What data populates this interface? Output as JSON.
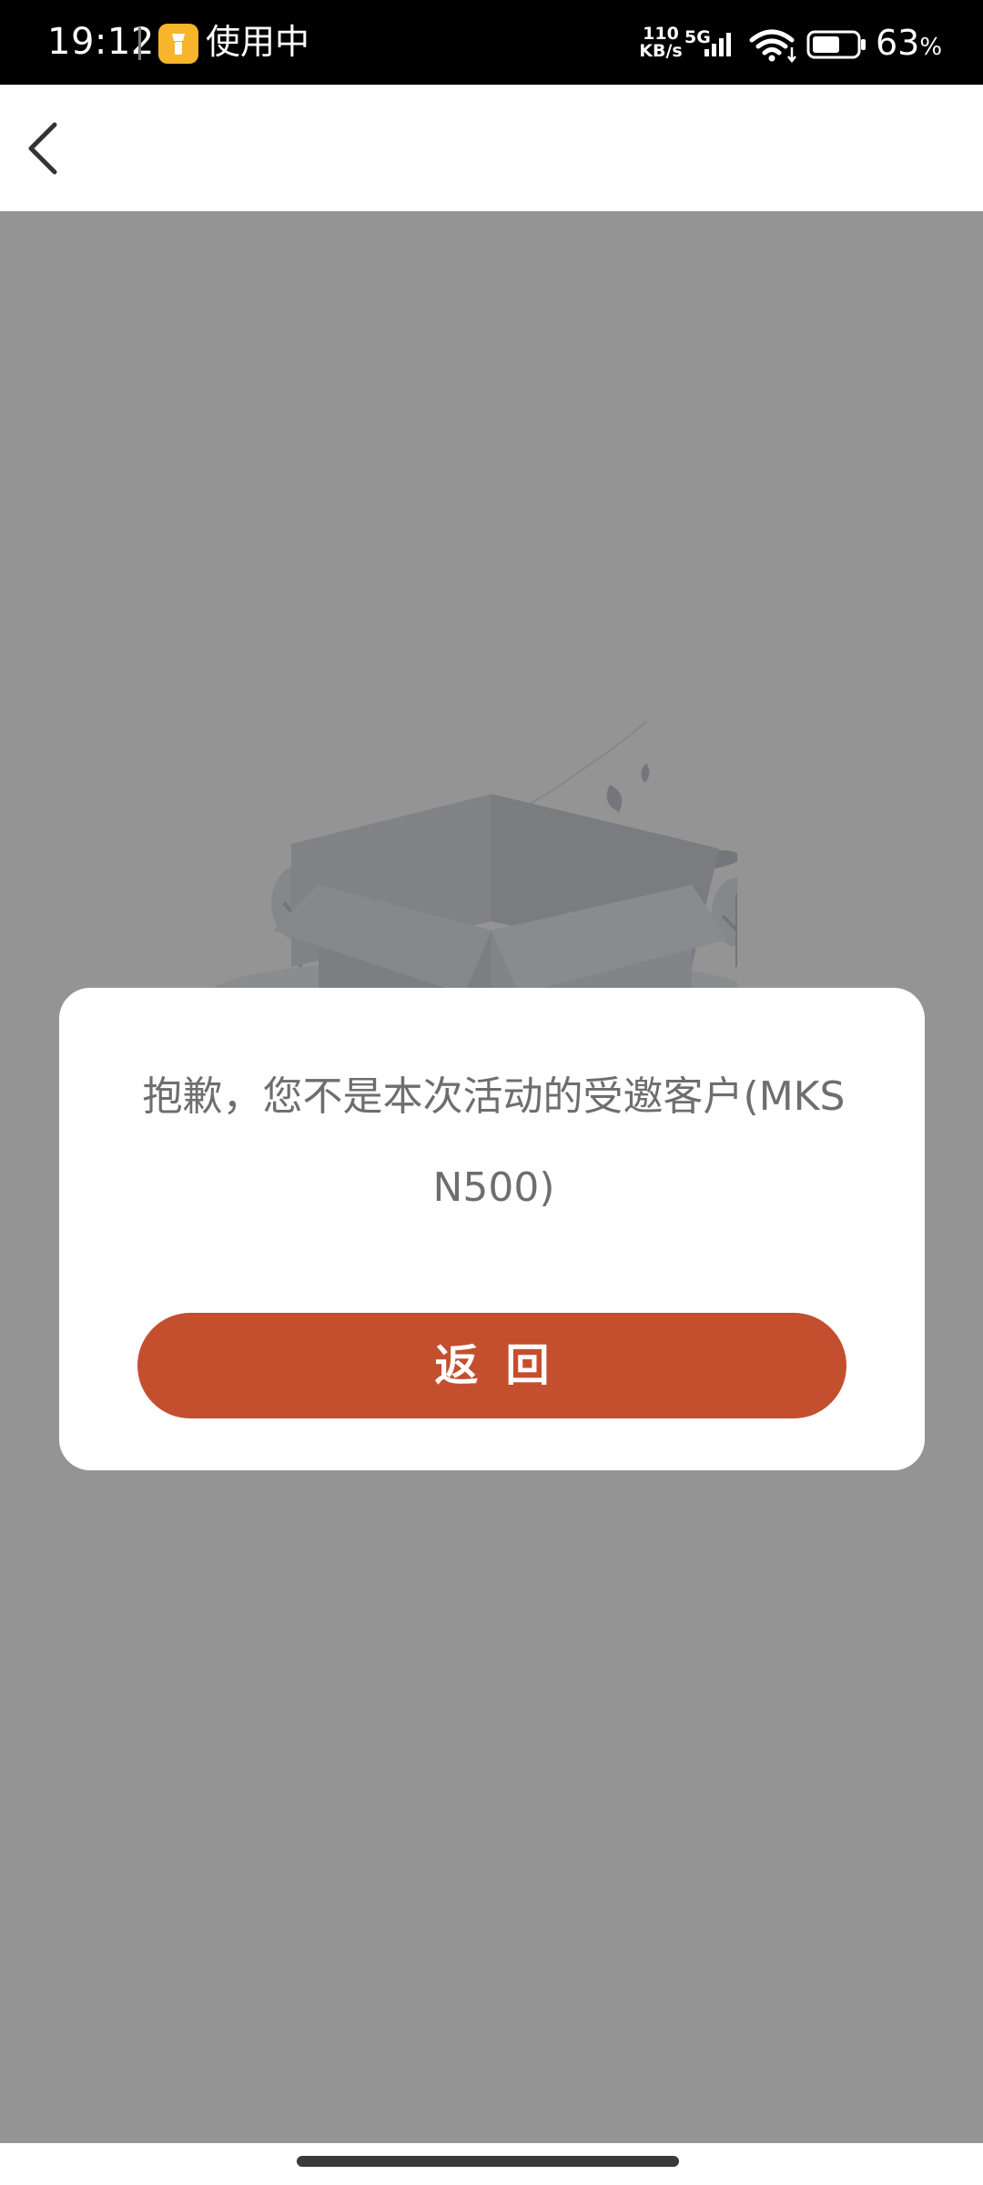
{
  "status_bar": {
    "time": "19:12",
    "app_label": "使用中",
    "app_icon": "flashlight-icon",
    "net_speed_value": "110",
    "net_speed_unit": "KB/s",
    "network_type": "5G",
    "signal_icon": "signal-bars-icon",
    "wifi_icon": "wifi-icon",
    "battery_icon": "battery-icon",
    "battery_value": "63",
    "battery_unit": "%",
    "battery_level": 0.63
  },
  "nav": {
    "back_icon": "chevron-left-icon"
  },
  "content": {
    "illustration": "empty-box-illustration"
  },
  "dialog": {
    "message": "抱歉，您不是本次活动的受邀客户(MKSN500)",
    "button_label": "返回"
  },
  "colors": {
    "accent": "#c44f2f",
    "status_bar_bg": "#000000",
    "overlay": "rgba(0,0,0,0.42)",
    "dialog_text": "#6e6e6e"
  }
}
